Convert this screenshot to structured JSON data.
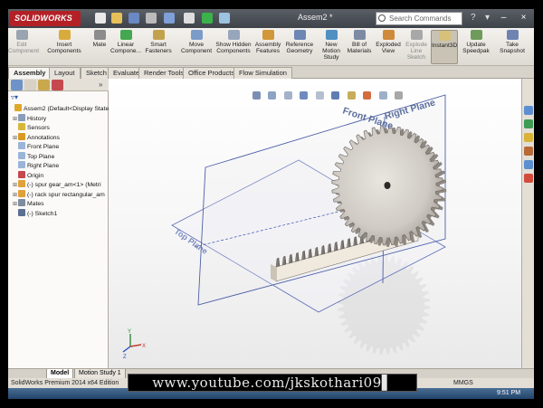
{
  "app": {
    "brand": "SOLIDWORKS",
    "document_title": "Assem2 *",
    "search_placeholder": "Search Commands",
    "edition": "SolidWorks Premium 2014 x64 Edition",
    "units": "MMGS",
    "clock": "9:51 PM"
  },
  "command_manager": [
    {
      "label": "Edit Component",
      "enabled": false,
      "icon": "edit-component-icon"
    },
    {
      "label": "Insert Components",
      "enabled": true,
      "icon": "insert-components-icon"
    },
    {
      "label": "Mate",
      "enabled": true,
      "icon": "mate-icon"
    },
    {
      "label": "Linear Compone...",
      "enabled": true,
      "icon": "linear-pattern-icon"
    },
    {
      "label": "Smart Fasteners",
      "enabled": true,
      "icon": "smart-fasteners-icon"
    },
    {
      "label": "Move Component",
      "enabled": true,
      "icon": "move-component-icon"
    },
    {
      "label": "Show Hidden Components",
      "enabled": true,
      "icon": "show-hidden-icon"
    },
    {
      "label": "Assembly Features",
      "enabled": true,
      "icon": "assembly-features-icon"
    },
    {
      "label": "Reference Geometry",
      "enabled": true,
      "icon": "reference-geometry-icon"
    },
    {
      "label": "New Motion Study",
      "enabled": true,
      "icon": "motion-study-icon"
    },
    {
      "label": "Bill of Materials",
      "enabled": true,
      "icon": "bom-icon"
    },
    {
      "label": "Exploded View",
      "enabled": true,
      "icon": "exploded-view-icon"
    },
    {
      "label": "Explode Line Sketch",
      "enabled": false,
      "icon": "explode-line-icon"
    },
    {
      "label": "Instant3D",
      "enabled": true,
      "active": true,
      "icon": "instant3d-icon"
    },
    {
      "label": "Update Speedpak",
      "enabled": true,
      "icon": "speedpak-icon"
    },
    {
      "label": "Take Snapshot",
      "enabled": true,
      "icon": "snapshot-icon"
    }
  ],
  "tabs": [
    "Assembly",
    "Layout",
    "Sketch",
    "Evaluate",
    "Render Tools",
    "Office Products",
    "Flow Simulation"
  ],
  "selected_tab": "Assembly",
  "feature_tree": [
    {
      "label": "Assem2  (Default<Display State",
      "indent": 0,
      "expander": "",
      "icon_color": "#e0a72a"
    },
    {
      "label": "History",
      "indent": 1,
      "expander": "+",
      "icon_color": "#8a9cb8"
    },
    {
      "label": "Sensors",
      "indent": 1,
      "expander": "",
      "icon_color": "#d6b73b"
    },
    {
      "label": "Annotations",
      "indent": 1,
      "expander": "+",
      "icon_color": "#d89a25"
    },
    {
      "label": "Front Plane",
      "indent": 1,
      "expander": "",
      "icon_color": "#9bb5d8"
    },
    {
      "label": "Top Plane",
      "indent": 1,
      "expander": "",
      "icon_color": "#9bb5d8"
    },
    {
      "label": "Right Plane",
      "indent": 1,
      "expander": "",
      "icon_color": "#9bb5d8"
    },
    {
      "label": "Origin",
      "indent": 1,
      "expander": "",
      "icon_color": "#c4484e"
    },
    {
      "label": "(-) spur gear_am<1> (Metri",
      "indent": 1,
      "expander": "+",
      "icon_color": "#e1a13a"
    },
    {
      "label": "(-) rack spur rectangular_am",
      "indent": 1,
      "expander": "+",
      "icon_color": "#e1a13a"
    },
    {
      "label": "Mates",
      "indent": 1,
      "expander": "+",
      "icon_color": "#7f8c9e"
    },
    {
      "label": "(-) Sketch1",
      "indent": 1,
      "expander": "",
      "icon_color": "#5b6f90"
    }
  ],
  "viewport": {
    "plane_labels": {
      "front": "Front Plane",
      "right": "Right Plane",
      "top": "Top Plane"
    },
    "gear_teeth": 40,
    "rack_teeth": 22
  },
  "bottom_tabs": [
    "Model",
    "Motion Study 1"
  ],
  "watermark": "www.youtube.com/jkskothari09▌",
  "colors": {
    "gear": "#cfcac4",
    "gear_dark": "#8d8881",
    "rack_face": "#f0e9de",
    "plane_edge": "#4c5fa8",
    "brand": "#b32026"
  }
}
